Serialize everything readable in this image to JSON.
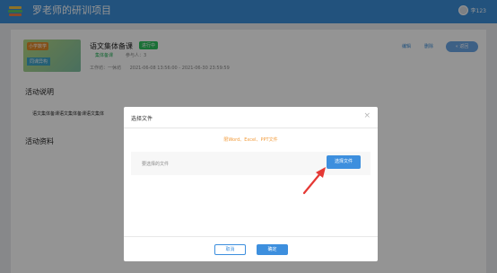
{
  "header": {
    "title": "罗老师的研训项目",
    "username": "李123",
    "logo_icon": "book-stack-icon"
  },
  "course": {
    "thumb_badge": "小学数学",
    "thumb_caption": "同课异构",
    "title": "语文集体备课",
    "status": "进行中",
    "category": "集体备课",
    "participants": "参与人：3",
    "location": "工作坊：一休坊",
    "time_range": "2021-06-08 13:56:00 - 2021-06-30 23:59:59",
    "actions": {
      "edit": "编辑",
      "delete": "删除",
      "back": "« 返回"
    }
  },
  "sections": {
    "description_title": "活动说明",
    "description_text": "语文集体备课语文集体备课语文集体",
    "materials_title": "活动资料"
  },
  "modal": {
    "title": "选择文件",
    "hint": "限Word、Excel、PPT文件",
    "file_label": "要选择的文件",
    "choose_button": "选择文件",
    "cancel_button": "取消",
    "ok_button": "确定"
  },
  "colors": {
    "header_bg": "#3c8dd8",
    "accent": "#3d8fde",
    "hint": "#f29b3b",
    "status": "#2ec15d",
    "arrow": "#e53935"
  }
}
